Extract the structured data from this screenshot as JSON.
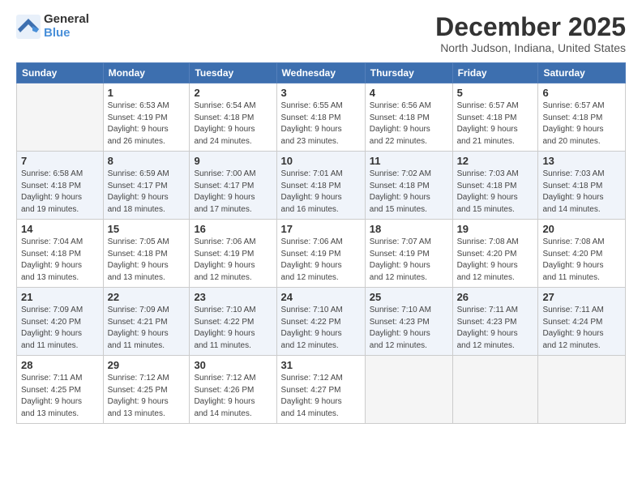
{
  "logo": {
    "general": "General",
    "blue": "Blue"
  },
  "title": {
    "month": "December 2025",
    "location": "North Judson, Indiana, United States"
  },
  "weekdays": [
    "Sunday",
    "Monday",
    "Tuesday",
    "Wednesday",
    "Thursday",
    "Friday",
    "Saturday"
  ],
  "weeks": [
    [
      {
        "day": "",
        "info": ""
      },
      {
        "day": "1",
        "info": "Sunrise: 6:53 AM\nSunset: 4:19 PM\nDaylight: 9 hours\nand 26 minutes."
      },
      {
        "day": "2",
        "info": "Sunrise: 6:54 AM\nSunset: 4:18 PM\nDaylight: 9 hours\nand 24 minutes."
      },
      {
        "day": "3",
        "info": "Sunrise: 6:55 AM\nSunset: 4:18 PM\nDaylight: 9 hours\nand 23 minutes."
      },
      {
        "day": "4",
        "info": "Sunrise: 6:56 AM\nSunset: 4:18 PM\nDaylight: 9 hours\nand 22 minutes."
      },
      {
        "day": "5",
        "info": "Sunrise: 6:57 AM\nSunset: 4:18 PM\nDaylight: 9 hours\nand 21 minutes."
      },
      {
        "day": "6",
        "info": "Sunrise: 6:57 AM\nSunset: 4:18 PM\nDaylight: 9 hours\nand 20 minutes."
      }
    ],
    [
      {
        "day": "7",
        "info": "Sunrise: 6:58 AM\nSunset: 4:18 PM\nDaylight: 9 hours\nand 19 minutes."
      },
      {
        "day": "8",
        "info": "Sunrise: 6:59 AM\nSunset: 4:17 PM\nDaylight: 9 hours\nand 18 minutes."
      },
      {
        "day": "9",
        "info": "Sunrise: 7:00 AM\nSunset: 4:17 PM\nDaylight: 9 hours\nand 17 minutes."
      },
      {
        "day": "10",
        "info": "Sunrise: 7:01 AM\nSunset: 4:18 PM\nDaylight: 9 hours\nand 16 minutes."
      },
      {
        "day": "11",
        "info": "Sunrise: 7:02 AM\nSunset: 4:18 PM\nDaylight: 9 hours\nand 15 minutes."
      },
      {
        "day": "12",
        "info": "Sunrise: 7:03 AM\nSunset: 4:18 PM\nDaylight: 9 hours\nand 15 minutes."
      },
      {
        "day": "13",
        "info": "Sunrise: 7:03 AM\nSunset: 4:18 PM\nDaylight: 9 hours\nand 14 minutes."
      }
    ],
    [
      {
        "day": "14",
        "info": "Sunrise: 7:04 AM\nSunset: 4:18 PM\nDaylight: 9 hours\nand 13 minutes."
      },
      {
        "day": "15",
        "info": "Sunrise: 7:05 AM\nSunset: 4:18 PM\nDaylight: 9 hours\nand 13 minutes."
      },
      {
        "day": "16",
        "info": "Sunrise: 7:06 AM\nSunset: 4:19 PM\nDaylight: 9 hours\nand 12 minutes."
      },
      {
        "day": "17",
        "info": "Sunrise: 7:06 AM\nSunset: 4:19 PM\nDaylight: 9 hours\nand 12 minutes."
      },
      {
        "day": "18",
        "info": "Sunrise: 7:07 AM\nSunset: 4:19 PM\nDaylight: 9 hours\nand 12 minutes."
      },
      {
        "day": "19",
        "info": "Sunrise: 7:08 AM\nSunset: 4:20 PM\nDaylight: 9 hours\nand 12 minutes."
      },
      {
        "day": "20",
        "info": "Sunrise: 7:08 AM\nSunset: 4:20 PM\nDaylight: 9 hours\nand 11 minutes."
      }
    ],
    [
      {
        "day": "21",
        "info": "Sunrise: 7:09 AM\nSunset: 4:20 PM\nDaylight: 9 hours\nand 11 minutes."
      },
      {
        "day": "22",
        "info": "Sunrise: 7:09 AM\nSunset: 4:21 PM\nDaylight: 9 hours\nand 11 minutes."
      },
      {
        "day": "23",
        "info": "Sunrise: 7:10 AM\nSunset: 4:22 PM\nDaylight: 9 hours\nand 11 minutes."
      },
      {
        "day": "24",
        "info": "Sunrise: 7:10 AM\nSunset: 4:22 PM\nDaylight: 9 hours\nand 12 minutes."
      },
      {
        "day": "25",
        "info": "Sunrise: 7:10 AM\nSunset: 4:23 PM\nDaylight: 9 hours\nand 12 minutes."
      },
      {
        "day": "26",
        "info": "Sunrise: 7:11 AM\nSunset: 4:23 PM\nDaylight: 9 hours\nand 12 minutes."
      },
      {
        "day": "27",
        "info": "Sunrise: 7:11 AM\nSunset: 4:24 PM\nDaylight: 9 hours\nand 12 minutes."
      }
    ],
    [
      {
        "day": "28",
        "info": "Sunrise: 7:11 AM\nSunset: 4:25 PM\nDaylight: 9 hours\nand 13 minutes."
      },
      {
        "day": "29",
        "info": "Sunrise: 7:12 AM\nSunset: 4:25 PM\nDaylight: 9 hours\nand 13 minutes."
      },
      {
        "day": "30",
        "info": "Sunrise: 7:12 AM\nSunset: 4:26 PM\nDaylight: 9 hours\nand 14 minutes."
      },
      {
        "day": "31",
        "info": "Sunrise: 7:12 AM\nSunset: 4:27 PM\nDaylight: 9 hours\nand 14 minutes."
      },
      {
        "day": "",
        "info": ""
      },
      {
        "day": "",
        "info": ""
      },
      {
        "day": "",
        "info": ""
      }
    ]
  ]
}
